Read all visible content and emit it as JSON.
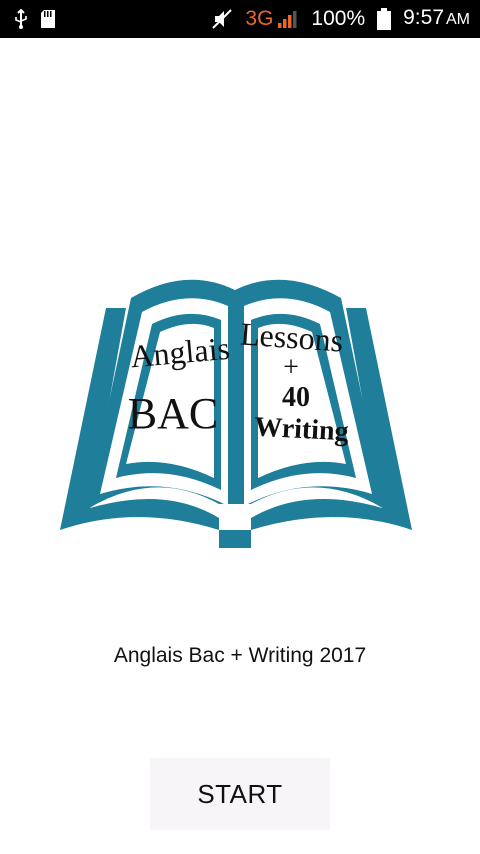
{
  "status_bar": {
    "network": "3G",
    "battery": "100%",
    "time": "9:57",
    "ampm": "AM"
  },
  "logo": {
    "left_words": [
      "Anglais",
      "BAC"
    ],
    "right_words": [
      "Lessons",
      "+",
      "40",
      "Writing"
    ],
    "color": "#1f7f9a"
  },
  "app_title": "Anglais Bac + Writing 2017",
  "start_button_label": "START"
}
